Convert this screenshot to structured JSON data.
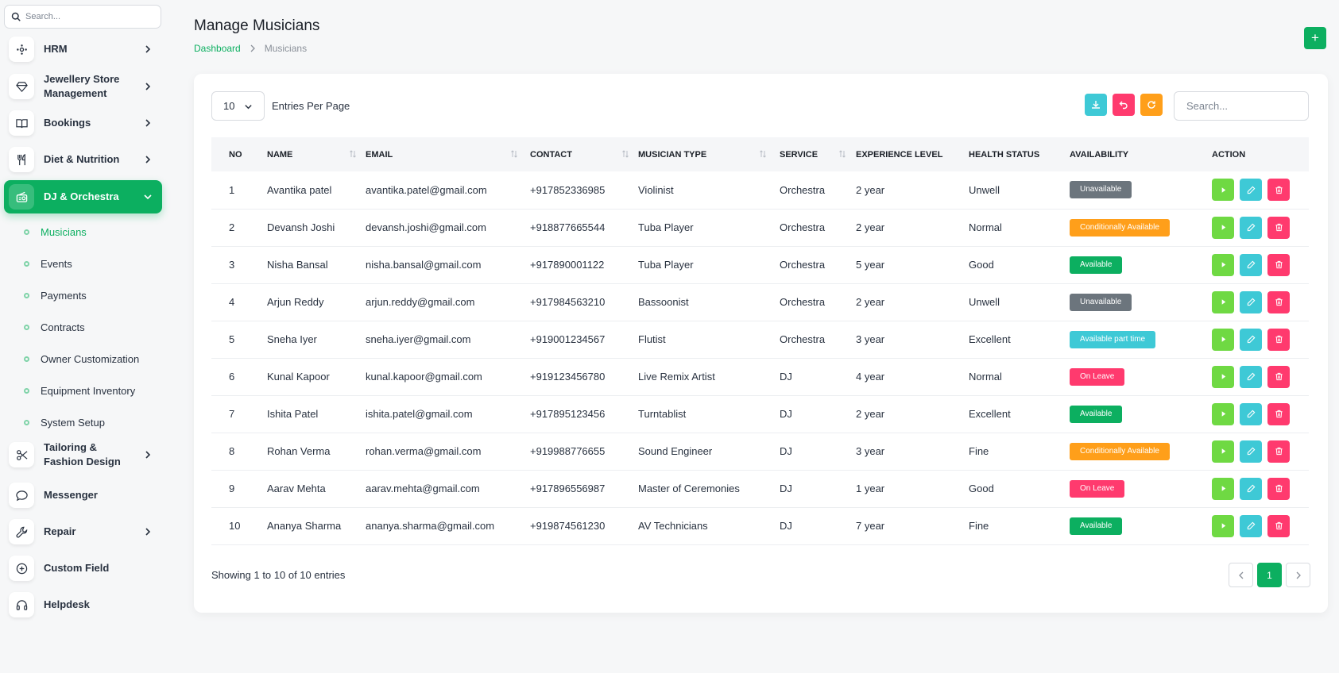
{
  "sidebar": {
    "search_placeholder": "Search...",
    "items": [
      {
        "label": "HRM",
        "icon": "hrm-icon",
        "chevron": true
      },
      {
        "label": "Jewellery Store Management",
        "icon": "diamond-icon",
        "chevron": true
      },
      {
        "label": "Bookings",
        "icon": "book-icon",
        "chevron": true
      },
      {
        "label": "Diet & Nutrition",
        "icon": "utensils-icon",
        "chevron": true
      },
      {
        "label": "DJ & Orchestra",
        "icon": "radio-icon",
        "chevron": true,
        "active": true
      },
      {
        "label": "Tailoring & Fashion Design",
        "icon": "scissors-icon",
        "chevron": true
      },
      {
        "label": "Messenger",
        "icon": "message-icon",
        "chevron": false
      },
      {
        "label": "Repair",
        "icon": "wrench-icon",
        "chevron": true
      },
      {
        "label": "Custom Field",
        "icon": "plus-circle-icon",
        "chevron": false
      },
      {
        "label": "Helpdesk",
        "icon": "headset-icon",
        "chevron": false
      }
    ],
    "subitems": [
      {
        "label": "Musicians",
        "active": true
      },
      {
        "label": "Events"
      },
      {
        "label": "Payments"
      },
      {
        "label": "Contracts"
      },
      {
        "label": "Owner Customization"
      },
      {
        "label": "Equipment Inventory"
      },
      {
        "label": "System Setup"
      }
    ]
  },
  "header": {
    "title": "Manage Musicians",
    "breadcrumb_home": "Dashboard",
    "breadcrumb_current": "Musicians",
    "add_label": "+"
  },
  "toolbar": {
    "entries_value": "10",
    "entries_label": "Entries Per Page",
    "search_placeholder": "Search..."
  },
  "table": {
    "columns": [
      "NO",
      "NAME",
      "EMAIL",
      "CONTACT",
      "MUSICIAN TYPE",
      "SERVICE",
      "EXPERIENCE LEVEL",
      "HEALTH STATUS",
      "AVAILABILITY",
      "ACTION"
    ],
    "rows": [
      {
        "no": "1",
        "name": "Avantika patel",
        "email": "avantika.patel@gmail.com",
        "contact": "+917852336985",
        "type": "Violinist",
        "service": "Orchestra",
        "exp": "2 year",
        "health": "Unwell",
        "avail": "Unavailable",
        "avail_color": "#6c757d"
      },
      {
        "no": "2",
        "name": "Devansh Joshi",
        "email": "devansh.joshi@gmail.com",
        "contact": "+918877665544",
        "type": "Tuba Player",
        "service": "Orchestra",
        "exp": "2 year",
        "health": "Normal",
        "avail": "Conditionally Available",
        "avail_color": "#ff9f1a"
      },
      {
        "no": "3",
        "name": "Nisha Bansal",
        "email": "nisha.bansal@gmail.com",
        "contact": "+917890001122",
        "type": "Tuba Player",
        "service": "Orchestra",
        "exp": "5 year",
        "health": "Good",
        "avail": "Available",
        "avail_color": "#0caf60"
      },
      {
        "no": "4",
        "name": "Arjun Reddy",
        "email": "arjun.reddy@gmail.com",
        "contact": "+917984563210",
        "type": "Bassoonist",
        "service": "Orchestra",
        "exp": "2 year",
        "health": "Unwell",
        "avail": "Unavailable",
        "avail_color": "#6c757d"
      },
      {
        "no": "5",
        "name": "Sneha Iyer",
        "email": "sneha.iyer@gmail.com",
        "contact": "+919001234567",
        "type": "Flutist",
        "service": "Orchestra",
        "exp": "3 year",
        "health": "Excellent",
        "avail": "Available part time",
        "avail_color": "#3ec9d6"
      },
      {
        "no": "6",
        "name": "Kunal Kapoor",
        "email": "kunal.kapoor@gmail.com",
        "contact": "+919123456780",
        "type": "Live Remix Artist",
        "service": "DJ",
        "exp": "4 year",
        "health": "Normal",
        "avail": "On Leave",
        "avail_color": "#ff3a6e"
      },
      {
        "no": "7",
        "name": "Ishita Patel",
        "email": "ishita.patel@gmail.com",
        "contact": "+917895123456",
        "type": "Turntablist",
        "service": "DJ",
        "exp": "2 year",
        "health": "Excellent",
        "avail": "Available",
        "avail_color": "#0caf60"
      },
      {
        "no": "8",
        "name": "Rohan Verma",
        "email": "rohan.verma@gmail.com",
        "contact": "+919988776655",
        "type": "Sound Engineer",
        "service": "DJ",
        "exp": "3 year",
        "health": "Fine",
        "avail": "Conditionally Available",
        "avail_color": "#ff9f1a"
      },
      {
        "no": "9",
        "name": "Aarav Mehta",
        "email": "aarav.mehta@gmail.com",
        "contact": "+917896556987",
        "type": "Master of Ceremonies",
        "service": "DJ",
        "exp": "1 year",
        "health": "Good",
        "avail": "On Leave",
        "avail_color": "#ff3a6e"
      },
      {
        "no": "10",
        "name": "Ananya Sharma",
        "email": "ananya.sharma@gmail.com",
        "contact": "+919874561230",
        "type": "AV Technicians",
        "service": "DJ",
        "exp": "7 year",
        "health": "Fine",
        "avail": "Available",
        "avail_color": "#0caf60"
      }
    ]
  },
  "footer": {
    "showing": "Showing 1 to 10 of 10 entries",
    "current_page": "1"
  },
  "colors": {
    "primary": "#0caf60",
    "download": "#3ec9d6",
    "reset": "#ff3a6e",
    "refresh": "#ff9f1a",
    "view": "#6fd943",
    "edit": "#3ec9d6",
    "delete": "#ff3a6e"
  }
}
